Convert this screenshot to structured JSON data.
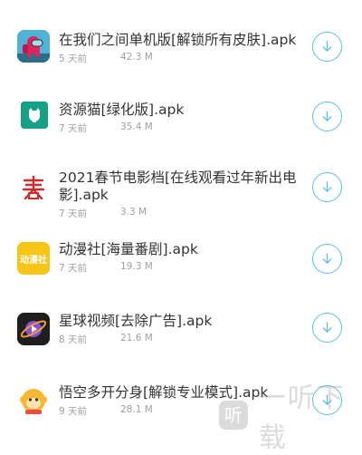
{
  "downloads": [
    {
      "name": "在我们之间单机版[解锁所有皮肤].apk",
      "time": "5 天前",
      "size": "42.3 M",
      "icon": "among-us-icon"
    },
    {
      "name": "资源猫[绿化版].apk",
      "time": "7 天前",
      "size": "35.4 M",
      "icon": "resource-cat-icon"
    },
    {
      "name": "2021春节电影档[在线观看过年新出电影].apk",
      "time": "7 天前",
      "size": "3.3 M",
      "icon": "spring-festival-icon"
    },
    {
      "name": "动漫社[海量番剧].apk",
      "time": "7 天前",
      "size": "19.3 M",
      "icon": "anime-club-icon",
      "icon_text": "动漫社"
    },
    {
      "name": "星球视频[去除广告].apk",
      "time": "8 天前",
      "size": "21.6 M",
      "icon": "planet-video-icon"
    },
    {
      "name": "悟空多开分身[解锁专业模式].apk",
      "time": "9 天前",
      "size": "28.1 M",
      "icon": "wukong-icon"
    }
  ],
  "download_icon": "download-arrow-icon",
  "watermark": {
    "text": "一听下载",
    "logo_text": "听"
  },
  "colors": {
    "accent": "#5bbde8",
    "title": "#333333",
    "meta": "#a0a0a0"
  }
}
